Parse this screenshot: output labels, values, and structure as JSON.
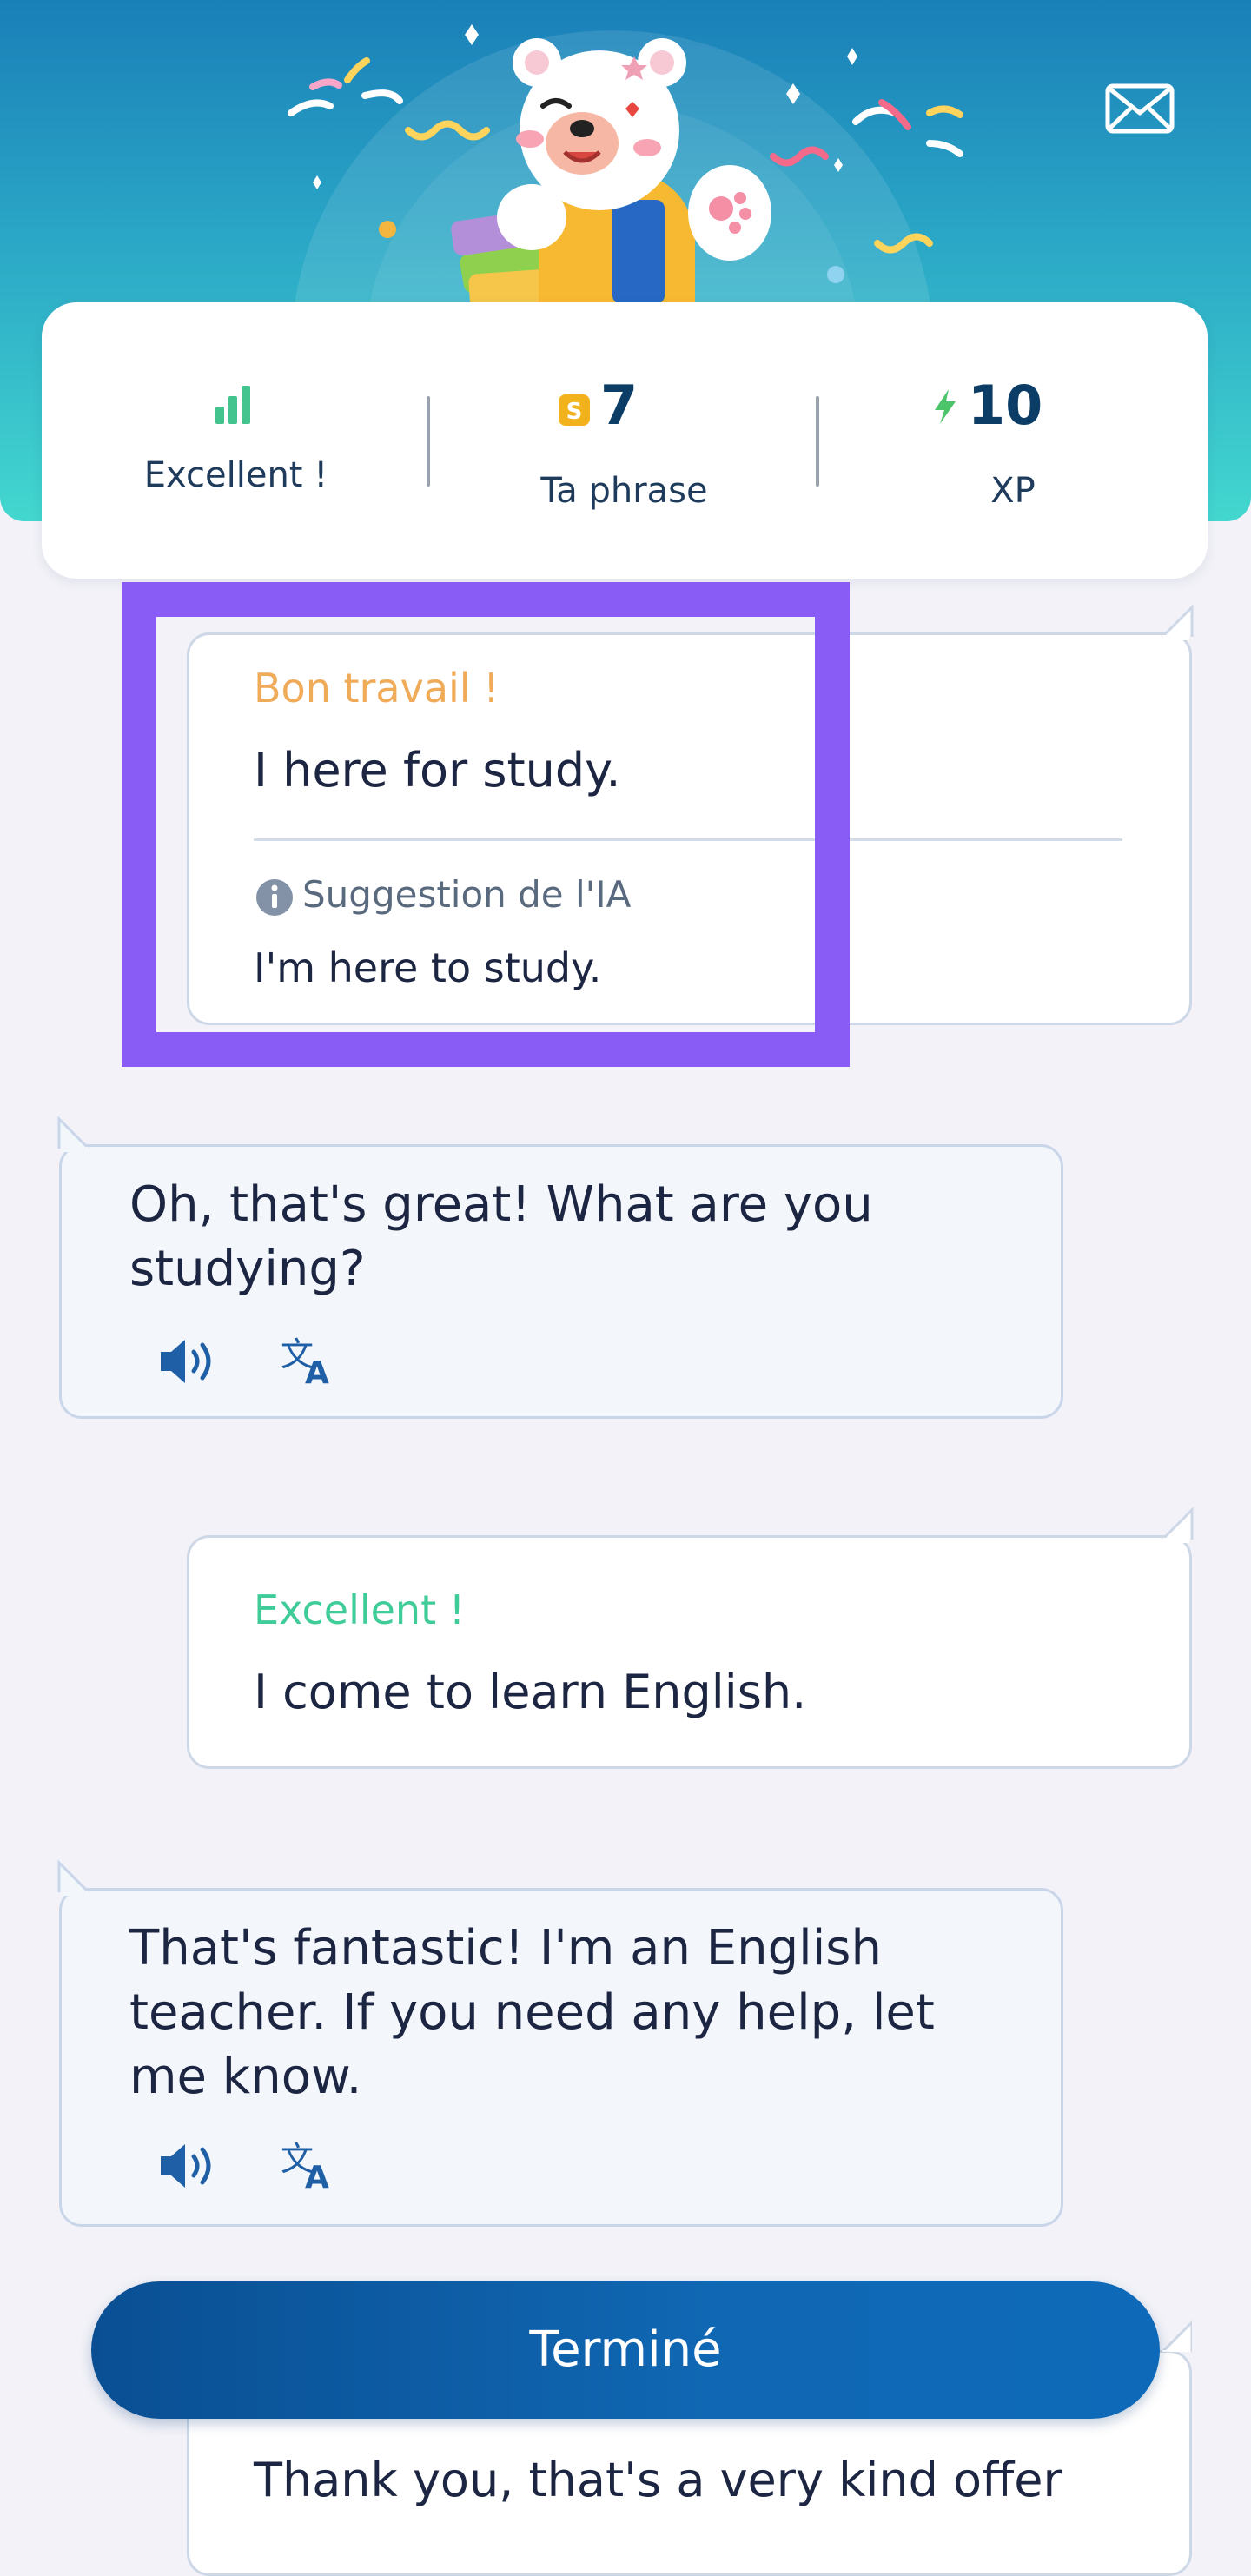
{
  "header": {
    "mail_icon": "envelope-icon",
    "mascot": "polar-bear-mascot"
  },
  "stats": {
    "rating": {
      "icon": "signal-bars-icon",
      "label": "Excellent !"
    },
    "sentence_score": {
      "icon": "coin-s-icon",
      "value": "7",
      "label": "Ta phrase"
    },
    "xp": {
      "icon": "lightning-icon",
      "value": "10",
      "label": "XP"
    }
  },
  "messages": [
    {
      "role": "user",
      "grade": "Bon travail !",
      "text": "I here for study.",
      "ai_label": "Suggestion de l'IA",
      "ai_suggestion": "I'm here to study."
    },
    {
      "role": "tutor",
      "text": "Oh, that's great! What are you studying?"
    },
    {
      "role": "user",
      "grade": "Excellent !",
      "text": "I come to learn English."
    },
    {
      "role": "tutor",
      "text": "That's fantastic! I'm an English teacher. If you need any help, let me know."
    },
    {
      "role": "user",
      "text": "Thank you, that's a very kind offer"
    }
  ],
  "done_button": {
    "label": "Terminé"
  },
  "colors": {
    "grade_good": "#f0ab59",
    "grade_excellent": "#3fcc98",
    "accent_blue": "#0b5aa0",
    "highlight": "#8a5cf6"
  }
}
